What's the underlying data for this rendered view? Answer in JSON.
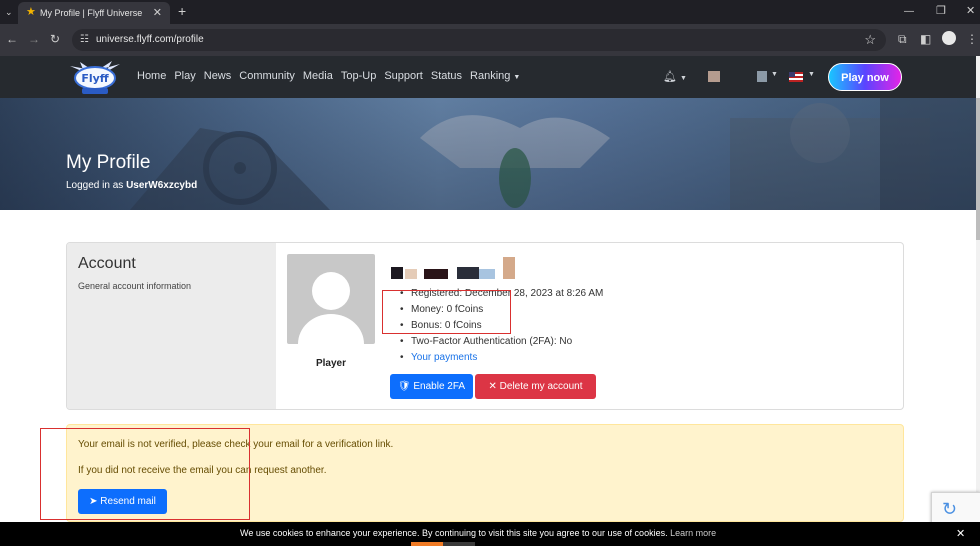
{
  "browser": {
    "tab_title": "My Profile | Flyff Universe",
    "url": "universe.flyff.com/profile",
    "tab_close": "✕",
    "new_tab": "+",
    "win_minimize": "—",
    "win_maximize": "❐",
    "win_close": "✕"
  },
  "nav": {
    "links": [
      "Home",
      "Play",
      "News",
      "Community",
      "Media",
      "Top-Up",
      "Support",
      "Status",
      "Ranking"
    ],
    "play_now": "Play now"
  },
  "banner": {
    "title": "My Profile",
    "logged_in_prefix": "Logged in as",
    "username": "UserW6xzcybd"
  },
  "account": {
    "title": "Account",
    "subtitle": "General account information",
    "player_label": "Player",
    "info": [
      "Registered: December 28, 2023 at 8:26 AM",
      "Money: 0 fCoins",
      "Bonus: 0 fCoins",
      "Two-Factor Authentication (2FA): No",
      "Your payments"
    ],
    "enable_2fa": "Enable 2FA",
    "delete_account": "Delete my account"
  },
  "alert": {
    "line1": "Your email is not verified, please check your email for a verification link.",
    "line2": "If you did not receive the email you can request another.",
    "resend": "Resend mail"
  },
  "cookie": {
    "text": "We use cookies to enhance your experience. By continuing to visit this site you agree to our use of cookies.",
    "learn_more": "Learn more",
    "close": "✕"
  },
  "colors": {
    "primary": "#0d6efd",
    "danger": "#dc3545",
    "alert_bg": "#fff3cd",
    "annotation_red": "#d9302f"
  }
}
